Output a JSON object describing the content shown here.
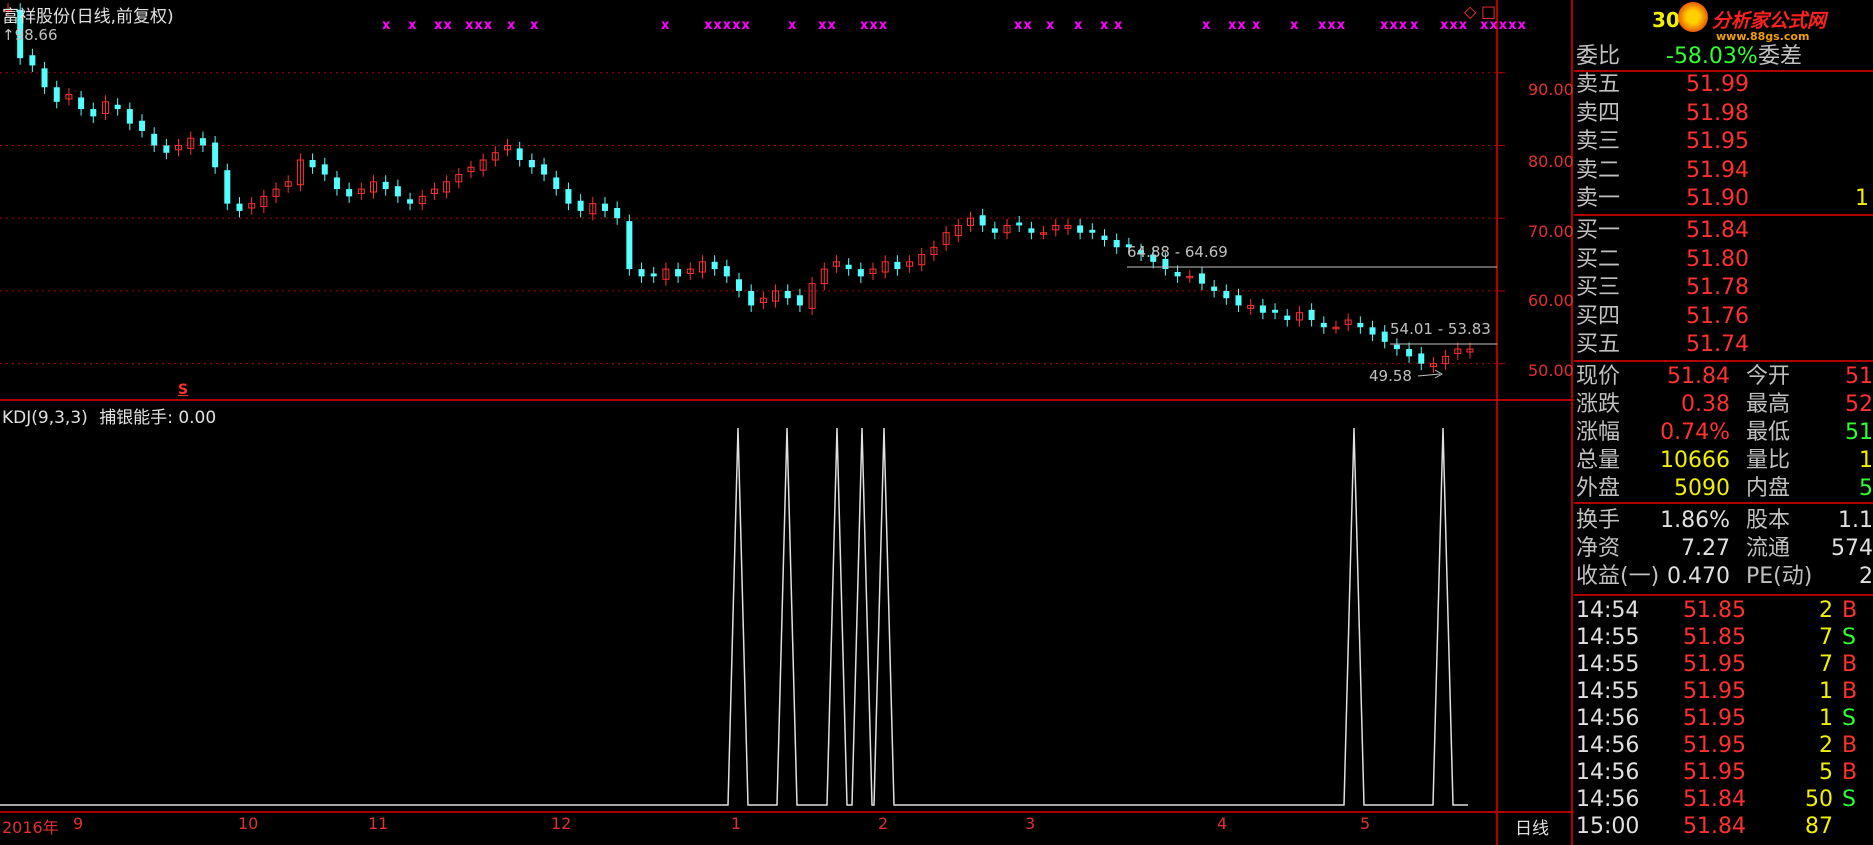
{
  "header": {
    "stock_title": "富祥股份(日线,前复权)",
    "ind_label": "KDJ(9,3,3)",
    "ind_name": "捕银能手",
    "ind_value": "0.00",
    "high_mark": "98.66",
    "period_label": "日线",
    "s_marker": "S"
  },
  "price_axis": [
    "90.00",
    "80.00",
    "70.00",
    "60.00",
    "50.00"
  ],
  "date_axis": [
    "2016年",
    "9",
    "10",
    "11",
    "12",
    "1",
    "2",
    "3",
    "4",
    "5"
  ],
  "price_marks": {
    "mark1": "64.88 - 64.69",
    "mark2": "54.01 - 53.83",
    "mark3": "49.58"
  },
  "x_marks": [
    "x",
    "x",
    "xx",
    "xxx",
    "x",
    "x",
    "x",
    "xxxxx",
    "x",
    "xx",
    "xxx",
    "xx",
    "x",
    "x",
    "x",
    "x",
    "x",
    "xx",
    "x",
    "x",
    "xxx",
    "xxx",
    "x",
    "xxx",
    "xxxxx"
  ],
  "icons": {
    "diamond": "diamond-icon",
    "square": "square-icon"
  },
  "side_header": {
    "code": "30",
    "logo_text": "分析家公式网",
    "logo_url": "www.88gs.com"
  },
  "order_ratio": {
    "label": "委比",
    "value": "-58.03%",
    "diff_label": "委差"
  },
  "sell_orders": [
    {
      "label": "卖五",
      "price": "51.99",
      "vol": ""
    },
    {
      "label": "卖四",
      "price": "51.98",
      "vol": ""
    },
    {
      "label": "卖三",
      "price": "51.95",
      "vol": ""
    },
    {
      "label": "卖二",
      "price": "51.94",
      "vol": ""
    },
    {
      "label": "卖一",
      "price": "51.90",
      "vol": "1"
    }
  ],
  "buy_orders": [
    {
      "label": "买一",
      "price": "51.84"
    },
    {
      "label": "买二",
      "price": "51.80"
    },
    {
      "label": "买三",
      "price": "51.78"
    },
    {
      "label": "买四",
      "price": "51.76"
    },
    {
      "label": "买五",
      "price": "51.74"
    }
  ],
  "quote": [
    {
      "l1": "现价",
      "v1": "51.84",
      "l2": "今开",
      "v2": "51"
    },
    {
      "l1": "涨跌",
      "v1": "0.38",
      "l2": "最高",
      "v2": "52"
    },
    {
      "l1": "涨幅",
      "v1": "0.74%",
      "l2": "最低",
      "v2": "51"
    },
    {
      "l1": "总量",
      "v1": "10666",
      "l2": "量比",
      "v2": "1"
    },
    {
      "l1": "外盘",
      "v1": "5090",
      "l2": "内盘",
      "v2": "5"
    }
  ],
  "fund": [
    {
      "l1": "换手",
      "v1": "1.86%",
      "l2": "股本",
      "v2": "1.1"
    },
    {
      "l1": "净资",
      "v1": "7.27",
      "l2": "流通",
      "v2": "574"
    },
    {
      "l1": "收益(一)",
      "v1": "0.470",
      "l2": "PE(动)",
      "v2": "2"
    }
  ],
  "ticks": [
    {
      "time": "14:54",
      "price": "51.85",
      "vol": "2",
      "bs": "B"
    },
    {
      "time": "14:55",
      "price": "51.85",
      "vol": "7",
      "bs": "S"
    },
    {
      "time": "14:55",
      "price": "51.95",
      "vol": "7",
      "bs": "B"
    },
    {
      "time": "14:55",
      "price": "51.95",
      "vol": "1",
      "bs": "B"
    },
    {
      "time": "14:56",
      "price": "51.95",
      "vol": "1",
      "bs": "S"
    },
    {
      "time": "14:56",
      "price": "51.95",
      "vol": "2",
      "bs": "B"
    },
    {
      "time": "14:56",
      "price": "51.95",
      "vol": "5",
      "bs": "B"
    },
    {
      "time": "14:56",
      "price": "51.84",
      "vol": "50",
      "bs": "S"
    },
    {
      "time": "15:00",
      "price": "51.84",
      "vol": "87",
      "bs": ""
    }
  ],
  "colors": {
    "up": "#ff3030",
    "down": "#54ffff",
    "grid": "#b00000",
    "magenta": "#ff00ff",
    "yellow": "#f0f000",
    "green": "#30ff30"
  },
  "chart_data": {
    "type": "candlestick",
    "ylim": [
      45,
      100
    ],
    "closes": [
      98.66,
      92,
      91,
      88,
      86,
      87,
      85,
      84,
      86,
      85,
      83,
      82,
      80,
      79,
      80,
      81,
      80,
      77,
      72,
      71,
      72,
      73,
      74,
      75,
      78,
      77,
      76,
      74,
      73,
      74,
      75,
      74,
      73,
      72,
      73,
      74,
      75,
      76,
      77,
      78,
      79,
      80,
      78,
      77,
      76,
      74,
      72,
      71,
      72,
      71,
      70,
      63,
      62,
      62,
      63,
      62,
      63,
      64,
      63,
      62,
      60,
      58,
      59,
      60,
      59,
      58,
      61,
      63,
      64,
      63,
      62,
      63,
      64,
      63,
      64,
      65,
      66,
      68,
      69,
      70,
      69,
      68,
      69,
      69,
      68,
      68,
      69,
      69,
      68,
      68,
      67,
      66,
      66,
      65,
      64,
      63,
      62,
      62,
      61,
      60,
      59,
      58,
      58,
      57,
      57,
      56,
      57,
      56,
      55,
      55,
      56,
      55,
      54,
      53,
      52,
      51,
      50,
      50,
      51,
      52,
      52
    ],
    "signal_peaks_index": [
      74,
      79,
      86,
      88,
      92,
      137,
      146
    ],
    "signal_range": [
      0,
      100
    ]
  }
}
